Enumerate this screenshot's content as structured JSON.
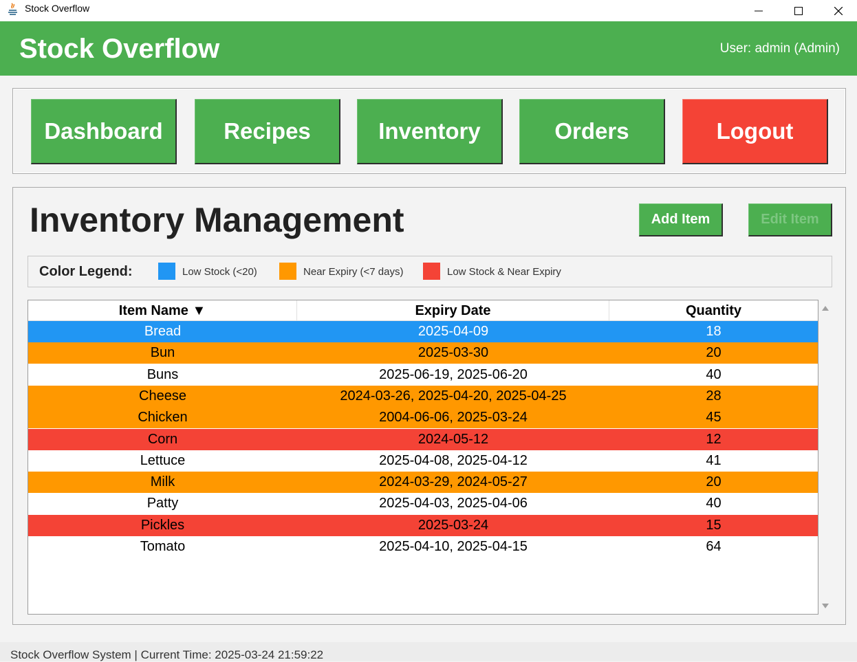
{
  "window": {
    "title": "Stock Overflow"
  },
  "header": {
    "brand": "Stock Overflow",
    "user": "User: admin (Admin)"
  },
  "nav": [
    {
      "label": "Dashboard",
      "name": "dashboard-button"
    },
    {
      "label": "Recipes",
      "name": "recipes-button"
    },
    {
      "label": "Inventory",
      "name": "inventory-button"
    },
    {
      "label": "Orders",
      "name": "orders-button"
    },
    {
      "label": "Logout",
      "name": "logout-button"
    }
  ],
  "page": {
    "title": "Inventory Management",
    "add_item": "Add Item",
    "edit_item": "Edit Item"
  },
  "legend": {
    "title": "Color Legend:",
    "items": [
      {
        "label": "Low Stock (<20)",
        "color": "#2196f3"
      },
      {
        "label": "Near Expiry (<7 days)",
        "color": "#ff9800"
      },
      {
        "label": "Low Stock & Near Expiry",
        "color": "#f44336"
      }
    ]
  },
  "table": {
    "columns": [
      "Item Name ▼",
      "Expiry Date",
      "Quantity"
    ],
    "rows": [
      {
        "name": "Bread",
        "expiry": "2025-04-09",
        "qty": "18",
        "status": "low"
      },
      {
        "name": "Bun",
        "expiry": "2025-03-30",
        "qty": "20",
        "status": "expiry"
      },
      {
        "name": "Buns",
        "expiry": "2025-06-19, 2025-06-20",
        "qty": "40",
        "status": "normal"
      },
      {
        "name": "Cheese",
        "expiry": "2024-03-26, 2025-04-20, 2025-04-25",
        "qty": "28",
        "status": "expiry"
      },
      {
        "name": "Chicken",
        "expiry": "2004-06-06, 2025-03-24",
        "qty": "45",
        "status": "expiry"
      },
      {
        "name": "Corn",
        "expiry": "2024-05-12",
        "qty": "12",
        "status": "both"
      },
      {
        "name": "Lettuce",
        "expiry": "2025-04-08, 2025-04-12",
        "qty": "41",
        "status": "normal"
      },
      {
        "name": "Milk",
        "expiry": "2024-03-29, 2024-05-27",
        "qty": "20",
        "status": "expiry"
      },
      {
        "name": "Patty",
        "expiry": "2025-04-03, 2025-04-06",
        "qty": "40",
        "status": "normal"
      },
      {
        "name": "Pickles",
        "expiry": "2025-03-24",
        "qty": "15",
        "status": "both"
      },
      {
        "name": "Tomato",
        "expiry": "2025-04-10, 2025-04-15",
        "qty": "64",
        "status": "normal"
      }
    ]
  },
  "colors": {
    "primary": "#4caf50",
    "danger": "#f44336",
    "low": "#2196f3",
    "expiry": "#ff9800",
    "both": "#f44336"
  },
  "status": {
    "text": "Stock Overflow System | Current Time: 2025-03-24 21:59:22"
  }
}
